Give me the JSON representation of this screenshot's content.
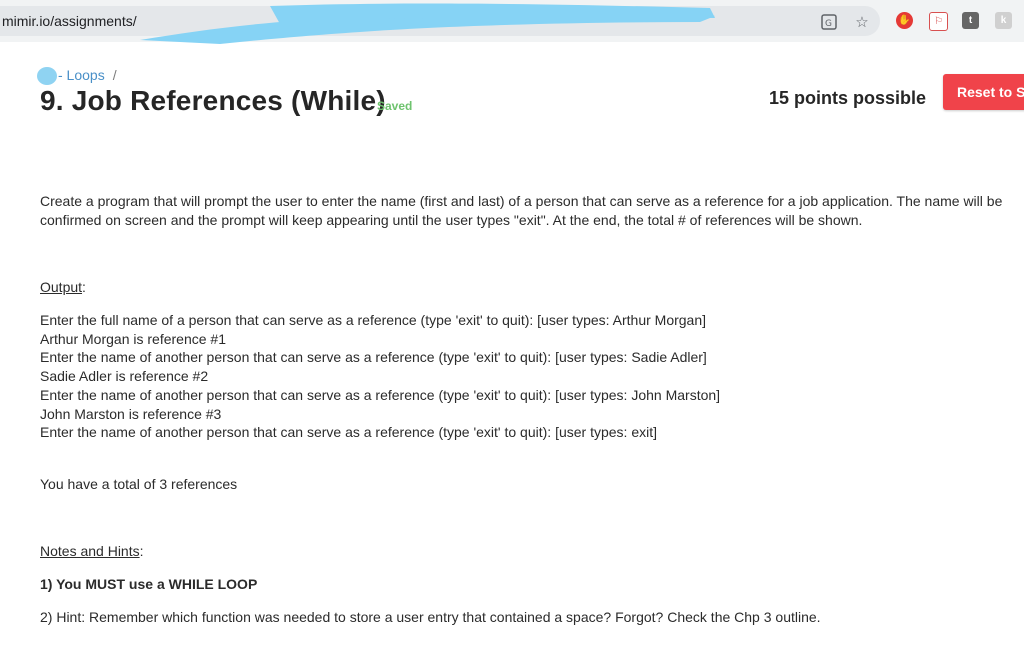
{
  "browser": {
    "url": "mimir.io/assignments/",
    "icons": [
      "translate-icon",
      "star-icon",
      "adblock-icon",
      "extension-icon-1",
      "extension-icon-2",
      "extension-icon-3"
    ]
  },
  "header": {
    "breadcrumb_label": "- Loops",
    "breadcrumb_separator": "/",
    "title": "9. Job References (While)",
    "saved_label": "Saved",
    "points": "15 points possible",
    "reset_label": "Reset to St"
  },
  "content": {
    "intro": "Create a program that will prompt the user to enter the name (first and last) of a person that can serve as a reference for a job application. The name will be confirmed on screen and the prompt will keep appearing until the user types \"exit\". At the end, the total # of references will be shown.",
    "output_heading": "Output",
    "output_lines": [
      "Enter the full name of a person that can serve as a reference (type 'exit' to quit):      [user types: Arthur Morgan]",
      "Arthur Morgan is reference #1",
      "Enter the name of another person that can serve as a reference (type 'exit' to quit):     [user types: Sadie Adler]",
      "Sadie Adler is reference #2",
      "Enter the name of another person that can serve as a reference (type 'exit' to quit):      [user types: John Marston]",
      "John Marston is reference #3",
      "Enter the name of another person that can serve as a reference (type 'exit' to quit):     [user types: exit]"
    ],
    "total_line": "You have a total of 3 references",
    "notes_heading": "Notes and Hints",
    "note_1": "1) You MUST use a WHILE LOOP",
    "note_2": "2) Hint: Remember which function was needed to store a user entry that contained a space? Forgot? Check the Chp 3 outline."
  },
  "colors": {
    "accent_button": "#f0434a",
    "link": "#4a90c8",
    "saved": "#6ec36e"
  }
}
